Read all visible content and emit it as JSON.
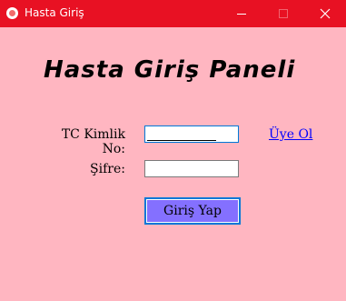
{
  "window": {
    "title": "Hasta Giriş",
    "icon": "app-icon"
  },
  "form": {
    "heading": "Hasta Giriş Paneli",
    "tc_label": "TC Kimlik No:",
    "tc_value": "",
    "password_label": "Şifre:",
    "password_value": "",
    "register_link": "Üye Ol",
    "login_button": "Giriş Yap"
  },
  "colors": {
    "titlebar": "#e81123",
    "background": "#ffb6c1",
    "button": "#8470ff",
    "link": "#0000ff",
    "focus_border": "#0078d7"
  }
}
